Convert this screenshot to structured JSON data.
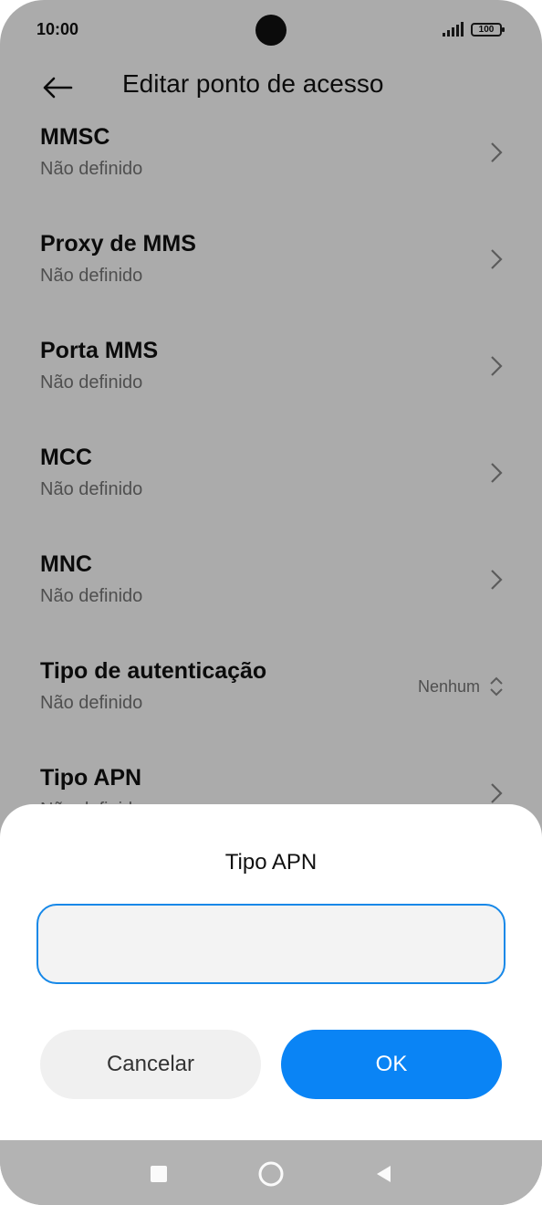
{
  "status_bar": {
    "time": "10:00",
    "battery": "100"
  },
  "header": {
    "title": "Editar ponto de acesso",
    "back_icon": "arrow-left-icon"
  },
  "settings": [
    {
      "title": "MMSC",
      "subtitle": "Não definido"
    },
    {
      "title": "Proxy de MMS",
      "subtitle": "Não definido"
    },
    {
      "title": "Porta MMS",
      "subtitle": "Não definido"
    },
    {
      "title": "MCC",
      "subtitle": "Não definido"
    },
    {
      "title": "MNC",
      "subtitle": "Não definido"
    },
    {
      "title": "Tipo de autenticação",
      "subtitle": "Não definido",
      "value": "Nenhum"
    },
    {
      "title": "Tipo APN",
      "subtitle": "Não definido"
    }
  ],
  "dialog": {
    "title": "Tipo APN",
    "input_value": "",
    "cancel_label": "Cancelar",
    "ok_label": "OK"
  },
  "colors": {
    "accent": "#0a84f5",
    "input_border": "#1688e8",
    "overlay": "rgba(0,0,0,0.33)",
    "navbar": "#b3b3b3"
  },
  "nav_icons": [
    "recents-square-icon",
    "home-circle-icon",
    "back-triangle-icon"
  ]
}
